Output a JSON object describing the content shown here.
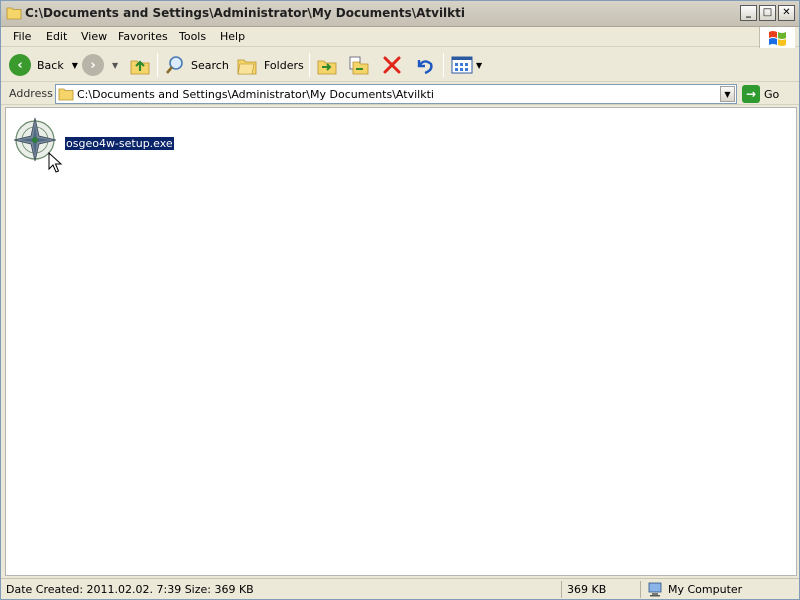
{
  "window": {
    "title": "C:\\Documents and Settings\\Administrator\\My Documents\\Atvilkti",
    "minimize": "_",
    "maximize": "□",
    "close": "✕"
  },
  "menubar": {
    "items": [
      "File",
      "Edit",
      "View",
      "Favorites",
      "Tools",
      "Help"
    ]
  },
  "toolbar": {
    "back_label": "Back",
    "search_label": "Search",
    "folders_label": "Folders"
  },
  "address": {
    "label": "Address",
    "path": "C:\\Documents and Settings\\Administrator\\My Documents\\Atvilkti",
    "go_label": "Go"
  },
  "content": {
    "files": [
      {
        "name": "osgeo4w-setup.exe",
        "selected": true,
        "icon": "osgeo-icon"
      }
    ]
  },
  "statusbar": {
    "details": "Date Created: 2011.02.02. 7:39 Size: 369 KB",
    "size": "369 KB",
    "zone": "My Computer"
  },
  "colors": {
    "selection": "#0a246a",
    "chrome": "#ece9d8"
  }
}
